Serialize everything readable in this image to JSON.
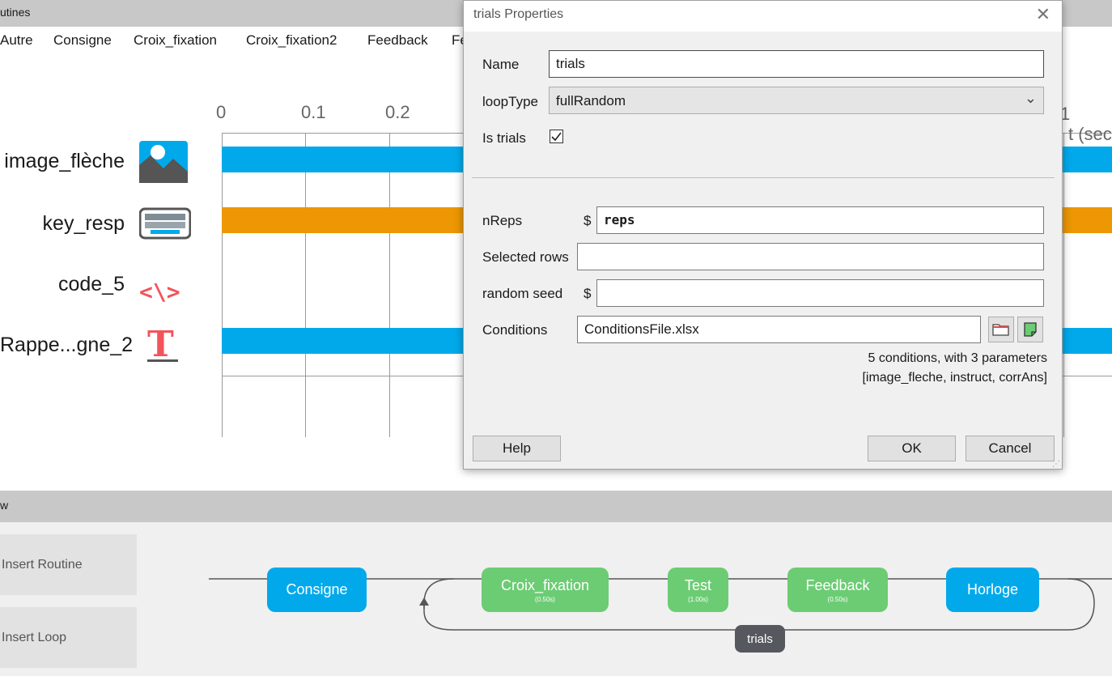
{
  "routines_panel": {
    "title": "utines",
    "tabs": [
      "Autre",
      "Consigne",
      "Croix_fixation",
      "Croix_fixation2",
      "Feedback",
      "Fe"
    ],
    "timeline": {
      "ticks": [
        "0",
        "0.1",
        "0.2"
      ],
      "tick_right": "1",
      "time_label": "t (sec",
      "components": [
        {
          "name": "image_flèche",
          "icon": "image-icon",
          "bar": "blue"
        },
        {
          "name": "key_resp",
          "icon": "keyboard-icon",
          "bar": "orange"
        },
        {
          "name": "code_5",
          "icon": "code-icon",
          "bar": "none"
        },
        {
          "name": "Rappe...gne_2",
          "icon": "text-icon",
          "bar": "blue"
        }
      ],
      "colors": {
        "blue": "#02a9ea",
        "orange": "#ec9703"
      }
    }
  },
  "flow_panel": {
    "title": "w",
    "insert_routine": "Insert Routine",
    "insert_loop": "Insert Loop",
    "nodes": [
      {
        "name": "Consigne",
        "duration": "",
        "color": "blue"
      },
      {
        "name": "Croix_fixation",
        "duration": "(0.50s)",
        "color": "green"
      },
      {
        "name": "Test",
        "duration": "(1.00s)",
        "color": "green"
      },
      {
        "name": "Feedback",
        "duration": "(0.50s)",
        "color": "green"
      },
      {
        "name": "Horloge",
        "duration": "",
        "color": "blue"
      }
    ],
    "loop_label": "trials"
  },
  "dialog": {
    "title": "trials Properties",
    "close_icon": "close-icon",
    "name_label": "Name",
    "name_value": "trials",
    "looptype_label": "loopType",
    "looptype_value": "fullRandom",
    "istrials_label": "Is trials",
    "istrials_checked": true,
    "nreps_label": "nReps",
    "nreps_value": "reps",
    "selected_rows_label": "Selected rows",
    "selected_rows_value": "",
    "random_seed_label": "random seed",
    "random_seed_value": "",
    "dollar": "$",
    "conditions_label": "Conditions",
    "conditions_value": "ConditionsFile.xlsx",
    "conditions_info_1": "5 conditions, with 3 parameters",
    "conditions_info_2": "[image_fleche, instruct, corrAns]",
    "help": "Help",
    "ok": "OK",
    "cancel": "Cancel"
  }
}
